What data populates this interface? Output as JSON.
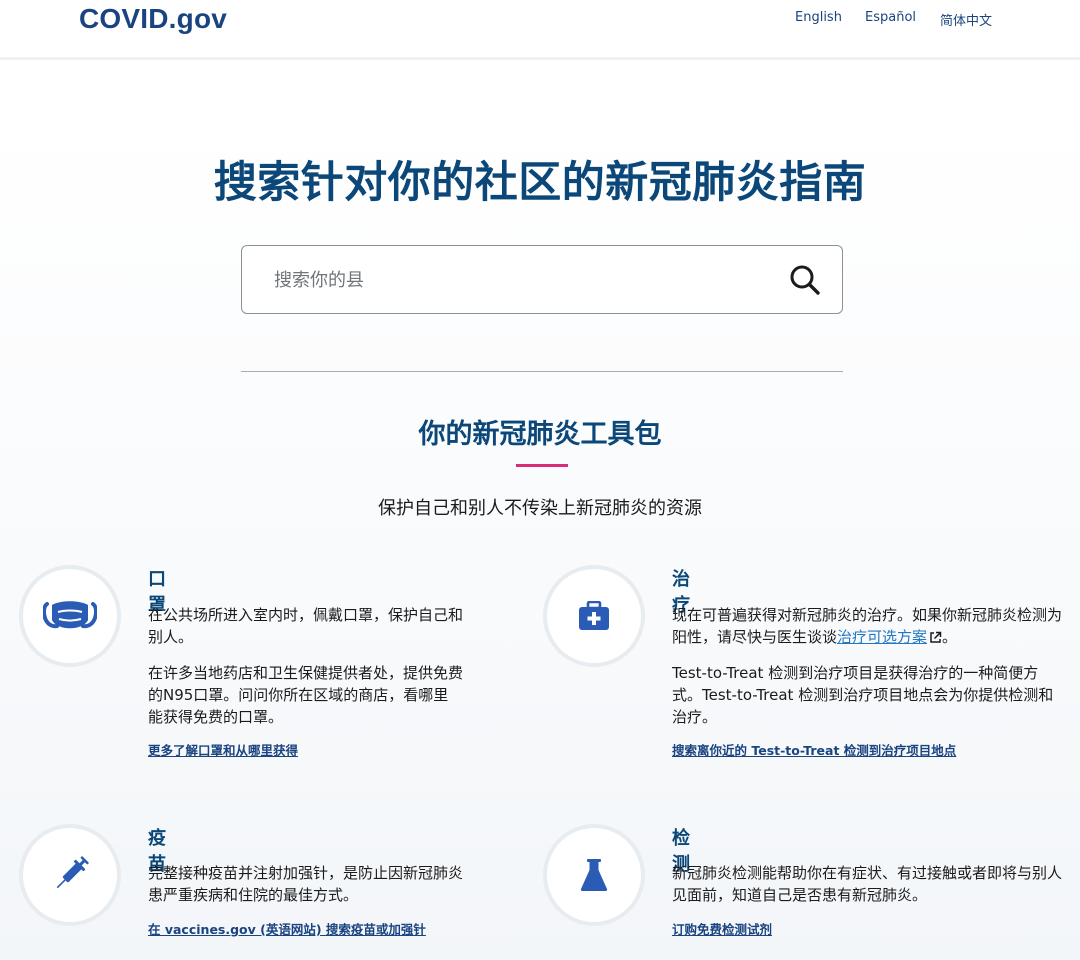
{
  "header": {
    "logo": "COVID.gov",
    "languages": [
      "English",
      "Español",
      "简体中文"
    ]
  },
  "hero": {
    "title": "搜索针对你的社区的新冠肺炎指南",
    "search": {
      "placeholder": "搜索你的县",
      "value": ""
    }
  },
  "toolkit": {
    "title": "你的新冠肺炎工具包",
    "subtitle": "保护自己和别人不传染上新冠肺炎的资源"
  },
  "cards": {
    "masks": {
      "icon": "mask-icon",
      "title": "口罩",
      "para1": "在公共场所进入室内时，佩戴口罩，保护自己和别人。",
      "para2": "在许多当地药店和卫生保健提供者处，提供免费的N95口罩。问问你所在区域的商店，看哪里能获得免费的口罩。",
      "link": "更多了解口罩和从哪里获得"
    },
    "treatment": {
      "icon": "medical-kit-icon",
      "title": "治疗",
      "para1_before": "现在可普遍获得对新冠肺炎的治疗。如果你新冠肺炎检测为阳性，请尽快与医生谈谈",
      "para1_link": "治疗可选方案",
      "para1_after": "。",
      "para2": "Test-to-Treat 检测到治疗项目是获得治疗的一种简便方式。Test-to-Treat 检测到治疗项目地点会为你提供检测和治疗。",
      "link": "搜索离你近的 Test-to-Treat 检测到治疗项目地点"
    },
    "vaccines": {
      "icon": "syringe-icon",
      "title": "疫苗",
      "para1": "完整接种疫苗并注射加强针，是防止因新冠肺炎患严重疾病和住院的最佳方式。",
      "link": "在 vaccines.gov (英语网站) 搜索疫苗或加强针"
    },
    "testing": {
      "icon": "flask-icon",
      "title": "检测",
      "para1": "新冠肺炎检测能帮助你在有症状、有过接触或者即将与别人见面前，知道自己是否患有新冠肺炎。",
      "link": "订购免费检测试剂"
    }
  },
  "colors": {
    "brand": "#1a4480",
    "heading": "#0b4778",
    "accent": "#d72d79",
    "icon": "#2a5bb5"
  }
}
